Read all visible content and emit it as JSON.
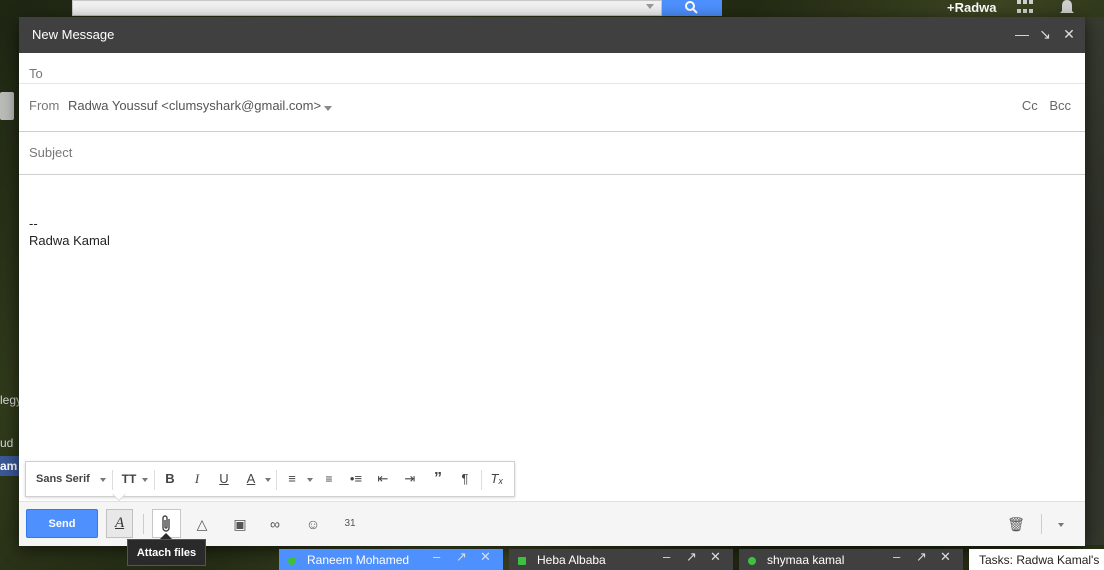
{
  "topbar": {
    "user_label": "+Radwa"
  },
  "compose": {
    "title": "New Message",
    "to_label": "To",
    "from_label": "From",
    "from_value": "Radwa Youssuf <clumsyshark@gmail.com>",
    "cc_label": "Cc",
    "bcc_label": "Bcc",
    "subject_placeholder": "Subject",
    "signature_dash": "--",
    "signature_name": "Radwa Kamal"
  },
  "format_toolbar": {
    "font_label": "Sans Serif"
  },
  "bottombar": {
    "send_label": "Send"
  },
  "tooltip": {
    "text": "Attach files"
  },
  "chat_tabs": [
    {
      "name": "Raneem Mohamed"
    },
    {
      "name": "Heba Albaba"
    },
    {
      "name": "shymaa kamal"
    },
    {
      "name": "Tasks: Radwa Kamal's"
    }
  ],
  "background": {
    "left_label_1": "legy",
    "left_label_2": "ud",
    "left_label_3": "am"
  }
}
